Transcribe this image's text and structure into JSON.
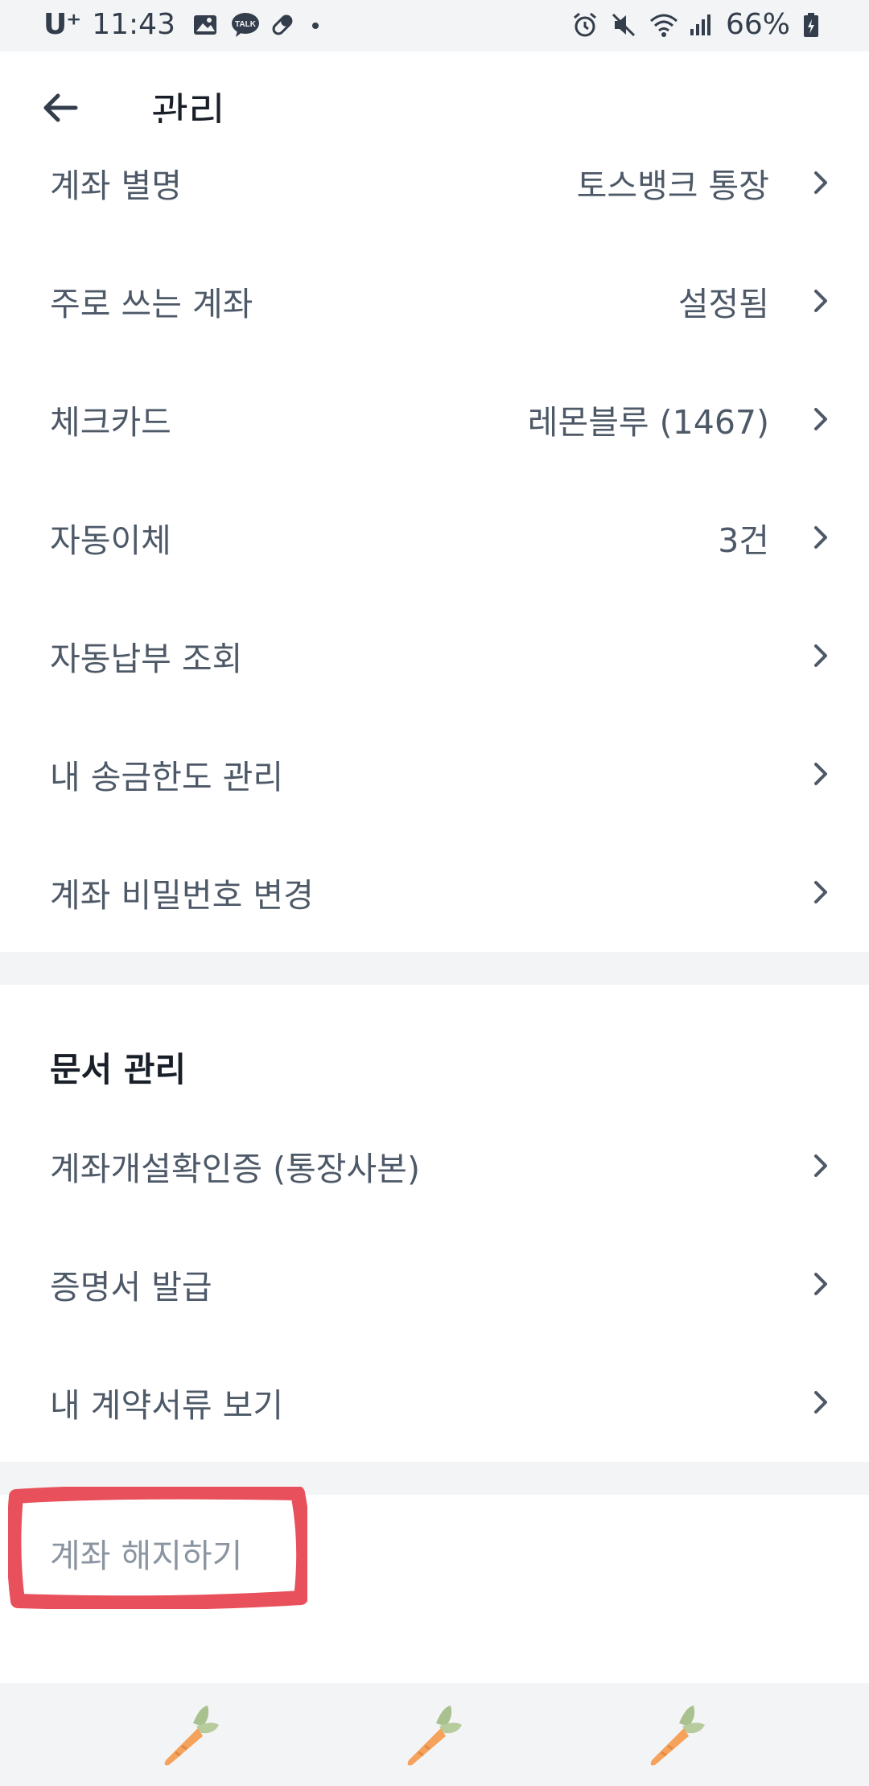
{
  "status_bar": {
    "carrier": "U⁺",
    "time": "11:43",
    "battery": "66%",
    "icons_left": [
      "gallery-icon",
      "talk-icon",
      "pill-icon",
      "dot-icon"
    ],
    "icons_right": [
      "alarm-icon",
      "mute-icon",
      "wifi-icon",
      "signal-icon",
      "battery-icon"
    ],
    "talk_badge": "TALK"
  },
  "header": {
    "title": "관리"
  },
  "account_settings": [
    {
      "label": "계좌 별명",
      "value": "토스뱅크 통장"
    },
    {
      "label": "주로 쓰는 계좌",
      "value": "설정됨"
    },
    {
      "label": "체크카드",
      "value": "레몬블루 (1467)"
    },
    {
      "label": "자동이체",
      "value": "3건"
    },
    {
      "label": "자동납부 조회",
      "value": ""
    },
    {
      "label": "내 송금한도 관리",
      "value": ""
    },
    {
      "label": "계좌 비밀번호 변경",
      "value": ""
    }
  ],
  "documents": {
    "section_title": "문서 관리",
    "items": [
      {
        "label": "계좌개설확인증 (통장사본)"
      },
      {
        "label": "증명서 발급"
      },
      {
        "label": "내 계약서류 보기"
      }
    ]
  },
  "close_account": {
    "label": "계좌 해지하기"
  },
  "colors": {
    "primary_text": "#191f28",
    "secondary_text": "#4e5968",
    "muted_text": "#8b95a1",
    "divider": "#f2f4f6",
    "highlight": "#e8505b"
  }
}
